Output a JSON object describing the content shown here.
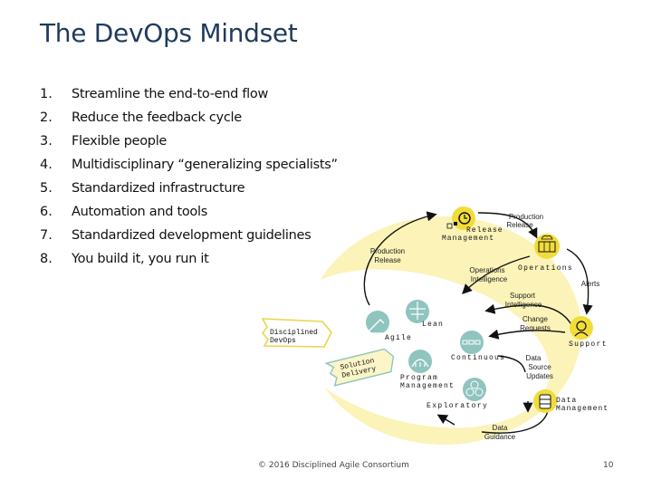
{
  "slide": {
    "title": "The DevOps Mindset",
    "items": [
      {
        "num": "1.",
        "text": "Streamline the end-to-end flow"
      },
      {
        "num": "2.",
        "text": "Reduce the feedback cycle"
      },
      {
        "num": "3.",
        "text": "Flexible people"
      },
      {
        "num": "4.",
        "text": "Multidisciplinary “generalizing specialists”"
      },
      {
        "num": "5.",
        "text": "Standardized infrastructure"
      },
      {
        "num": "6.",
        "text": "Automation and tools"
      },
      {
        "num": "7.",
        "text": "Standardized development guidelines"
      },
      {
        "num": "8.",
        "text": "You build it, you run it"
      }
    ],
    "footer": "© 2016 Disciplined Agile Consortium",
    "page_number": "10"
  },
  "diagram": {
    "colors": {
      "outer_ring": "#fbf3b8",
      "node_yellow": "#f2dc3a",
      "inner_teal": "#8fc4bf",
      "arrow": "#111111"
    },
    "banners": {
      "disciplined_devops": [
        "Disciplined",
        "DevOps"
      ],
      "solution_delivery": [
        "Solution",
        "Delivery"
      ]
    },
    "outer_nodes": {
      "release_management": [
        "Release",
        "Management"
      ],
      "operations": "Operations",
      "support": "Support",
      "data_management": [
        "Data",
        "Management"
      ]
    },
    "inner_nodes": {
      "agile": "Agile",
      "lean": "Lean",
      "continuous": "Continuous",
      "program_management": [
        "Program",
        "Management"
      ],
      "exploratory": "Exploratory"
    },
    "flow_labels": {
      "production_release_left": [
        "Production",
        "Release"
      ],
      "production_release_top": [
        "Production",
        "Release"
      ],
      "operations_intelligence": [
        "Operations",
        "Intelligence"
      ],
      "alerts": "Alerts",
      "support_intelligence": [
        "Support",
        "Intelligence"
      ],
      "change_requests": [
        "Change",
        "Requests"
      ],
      "data_source_updates": [
        "Data",
        "Source",
        "Updates"
      ],
      "data_guidance": [
        "Data",
        "Guidance"
      ]
    }
  }
}
